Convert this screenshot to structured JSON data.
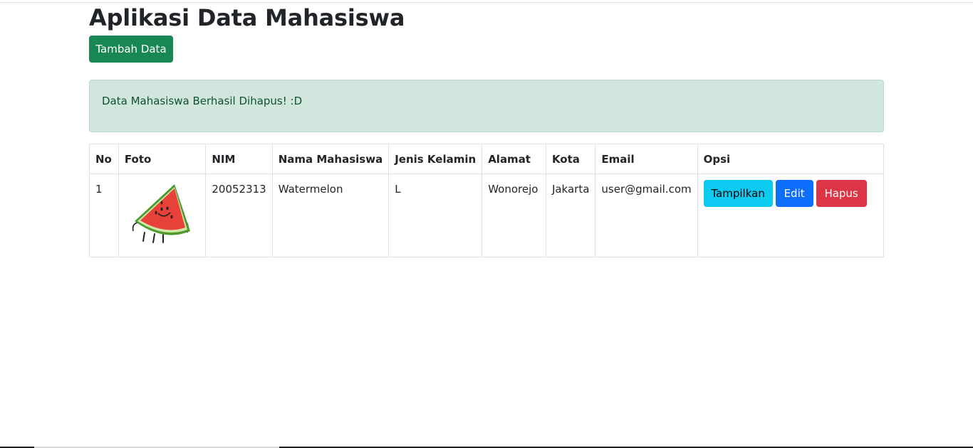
{
  "page": {
    "title": "Aplikasi Data Mahasiswa",
    "add_button": "Tambah Data",
    "alert": "Data Mahasiswa Berhasil Dihapus! :D"
  },
  "table": {
    "headers": [
      "No",
      "Foto",
      "NIM",
      "Nama Mahasiswa",
      "Jenis Kelamin",
      "Alamat",
      "Kota",
      "Email",
      "Opsi"
    ],
    "rows": [
      {
        "no": "1",
        "foto": "watermelon-character-image",
        "nim": "20052313",
        "nama": "Watermelon",
        "jenis_kelamin": "L",
        "alamat": "Wonorejo",
        "kota": "Jakarta",
        "email": "user@gmail.com",
        "actions": {
          "show": "Tampilkan",
          "edit": "Edit",
          "delete": "Hapus"
        }
      }
    ]
  },
  "colors": {
    "success": "#198754",
    "alert_bg": "#d1e7dd",
    "alert_text": "#0f5132",
    "info": "#0dcaf0",
    "primary": "#0d6efd",
    "danger": "#dc3545"
  }
}
